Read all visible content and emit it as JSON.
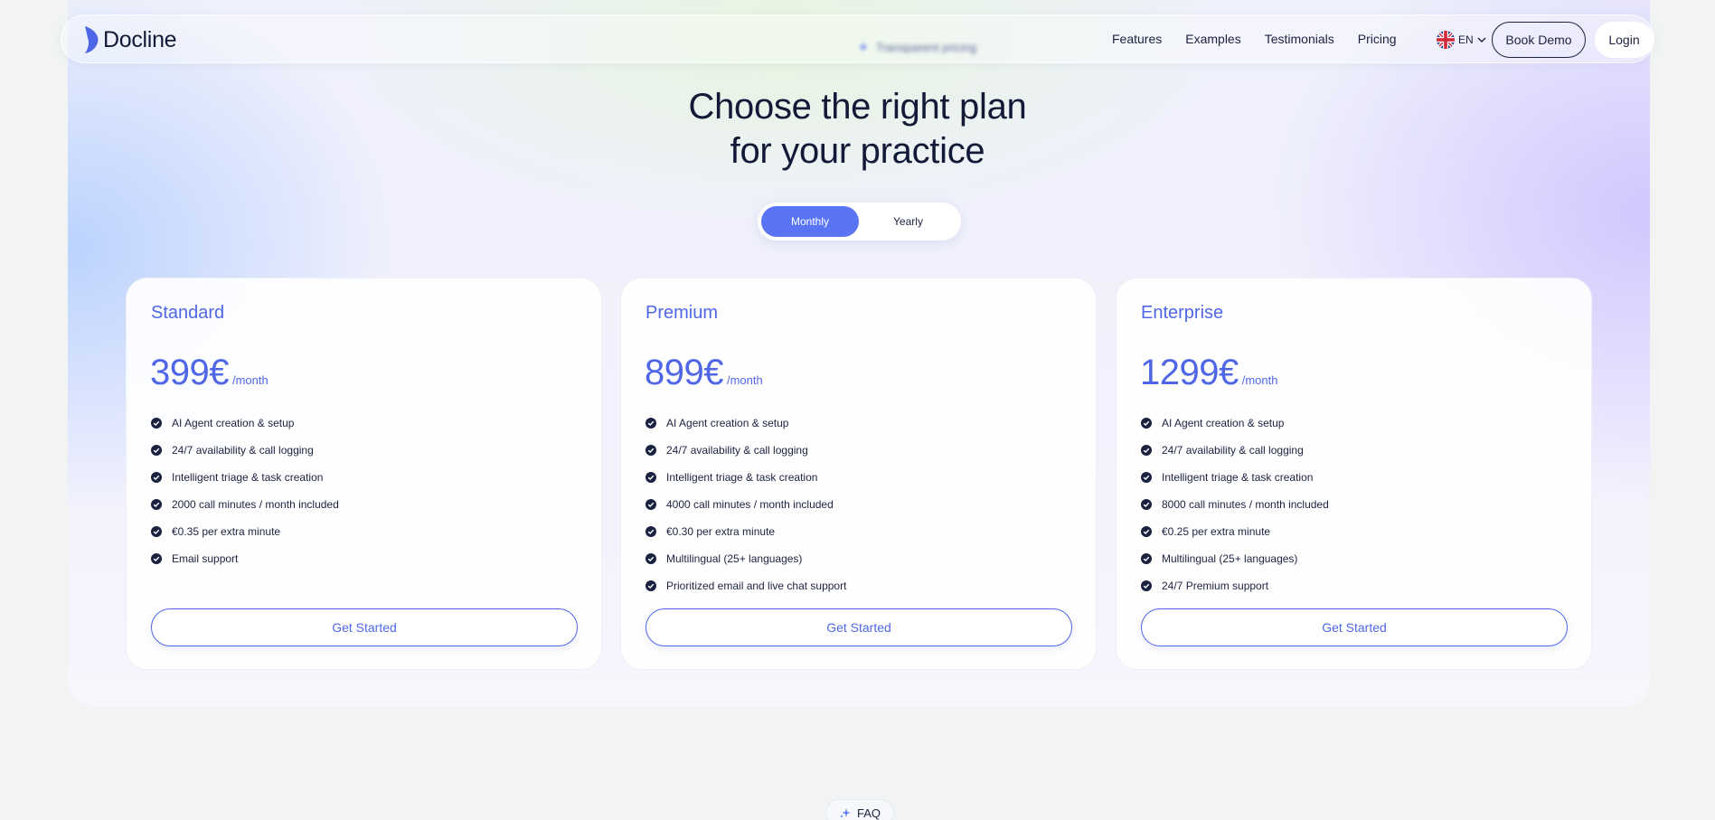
{
  "brand": {
    "name": "Docline",
    "accent": "#5a74f6",
    "dark": "#121a38"
  },
  "nav": {
    "section_chip": "Transparent pricing",
    "links": [
      "Features",
      "Examples",
      "Testimonials",
      "Pricing"
    ],
    "language": "EN",
    "book_demo": "Book Demo",
    "login": "Login"
  },
  "hero": {
    "title_line1": "Choose the right plan",
    "title_line2": "for your practice"
  },
  "billing_toggle": {
    "monthly": "Monthly",
    "yearly": "Yearly",
    "selected": "Monthly"
  },
  "plans": [
    {
      "name": "Standard",
      "price": "399€",
      "period": "/month",
      "features": [
        "AI Agent creation & setup",
        "24/7 availability & call logging",
        "Intelligent triage & task creation",
        "2000 call minutes / month included",
        "€0.35 per extra minute",
        "Email support"
      ],
      "cta": "Get Started"
    },
    {
      "name": "Premium",
      "price": "899€",
      "period": "/month",
      "features": [
        "AI Agent creation & setup",
        "24/7 availability & call logging",
        "Intelligent triage & task creation",
        "4000 call minutes / month included",
        "€0.30 per extra minute",
        "Multilingual (25+ languages)",
        "Prioritized email and live chat support"
      ],
      "cta": "Get Started"
    },
    {
      "name": "Enterprise",
      "price": "1299€",
      "period": "/month",
      "features": [
        "AI Agent creation & setup",
        "24/7 availability & call logging",
        "Intelligent triage & task creation",
        "8000 call minutes / month included",
        "€0.25 per extra minute",
        "Multilingual (25+ languages)",
        "24/7 Premium support"
      ],
      "cta": "Get Started"
    }
  ],
  "faq": {
    "label": "FAQ"
  }
}
